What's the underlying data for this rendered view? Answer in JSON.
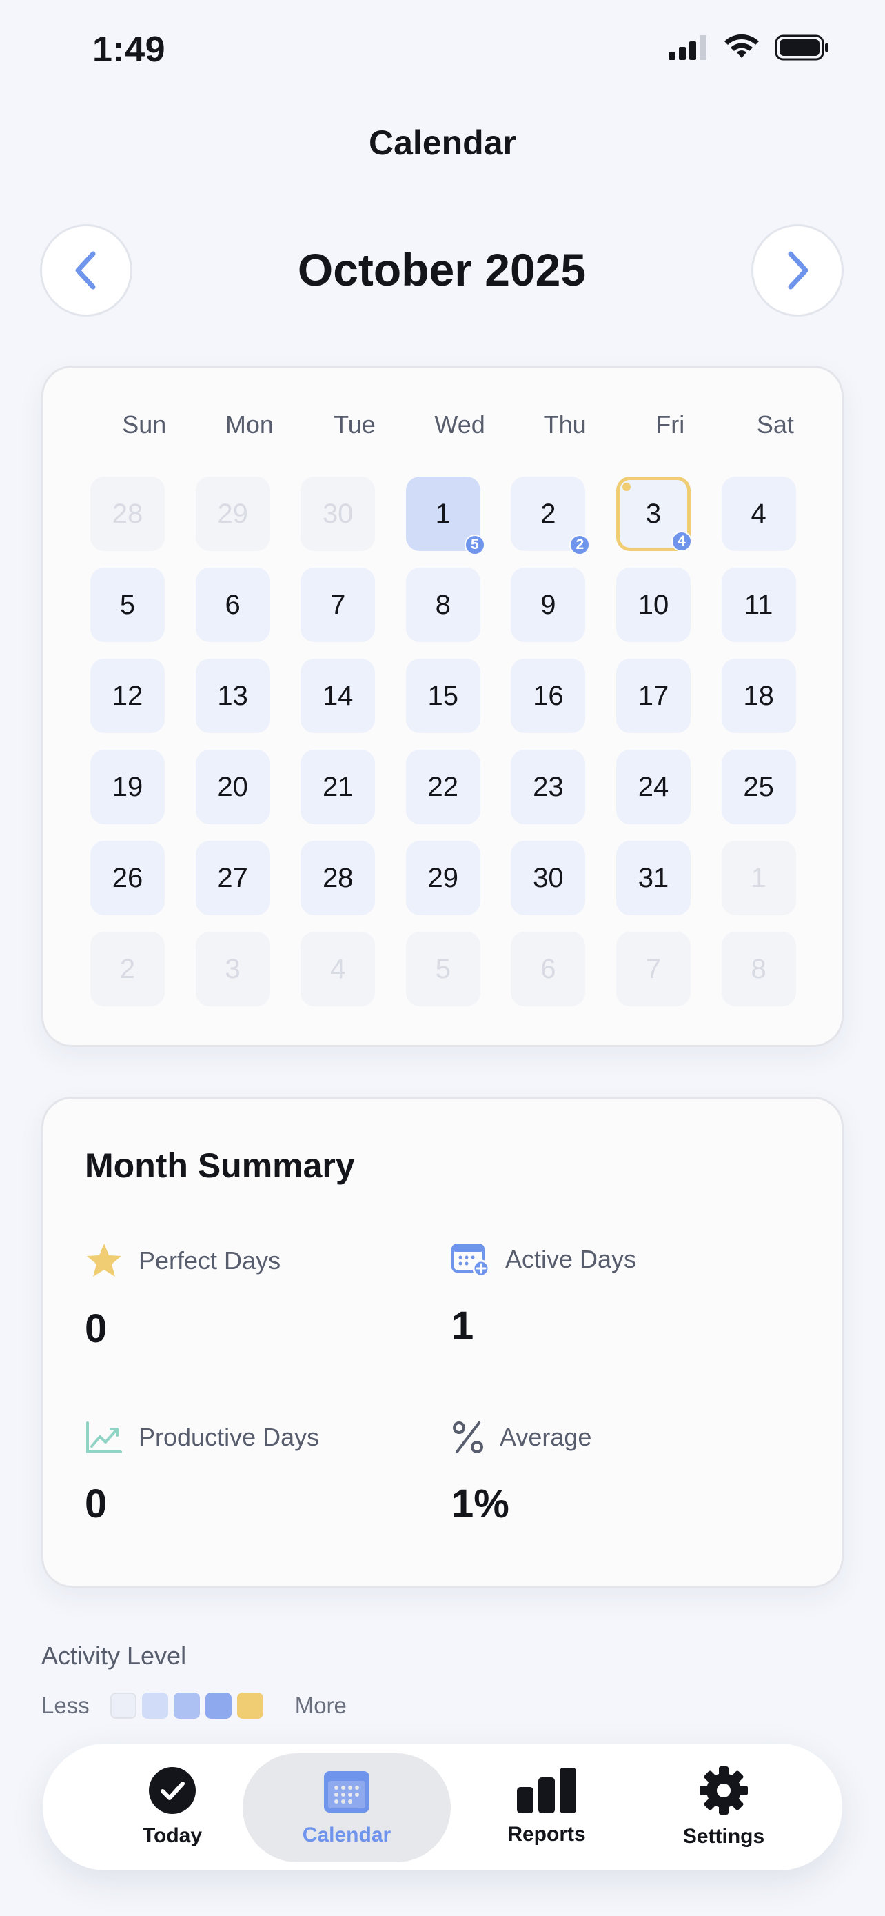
{
  "status_bar": {
    "time": "1:49"
  },
  "header": {
    "title": "Calendar"
  },
  "month_nav": {
    "label": "October 2025"
  },
  "calendar": {
    "weekdays": [
      "Sun",
      "Mon",
      "Tue",
      "Wed",
      "Thu",
      "Fri",
      "Sat"
    ],
    "days": [
      {
        "n": "28",
        "state": "muted"
      },
      {
        "n": "29",
        "state": "muted"
      },
      {
        "n": "30",
        "state": "muted"
      },
      {
        "n": "1",
        "state": "active",
        "badge": "5"
      },
      {
        "n": "2",
        "state": "normal",
        "badge": "2"
      },
      {
        "n": "3",
        "state": "today",
        "badge": "4"
      },
      {
        "n": "4",
        "state": "normal"
      },
      {
        "n": "5",
        "state": "normal"
      },
      {
        "n": "6",
        "state": "normal"
      },
      {
        "n": "7",
        "state": "normal"
      },
      {
        "n": "8",
        "state": "normal"
      },
      {
        "n": "9",
        "state": "normal"
      },
      {
        "n": "10",
        "state": "normal"
      },
      {
        "n": "11",
        "state": "normal"
      },
      {
        "n": "12",
        "state": "normal"
      },
      {
        "n": "13",
        "state": "normal"
      },
      {
        "n": "14",
        "state": "normal"
      },
      {
        "n": "15",
        "state": "normal"
      },
      {
        "n": "16",
        "state": "normal"
      },
      {
        "n": "17",
        "state": "normal"
      },
      {
        "n": "18",
        "state": "normal"
      },
      {
        "n": "19",
        "state": "normal"
      },
      {
        "n": "20",
        "state": "normal"
      },
      {
        "n": "21",
        "state": "normal"
      },
      {
        "n": "22",
        "state": "normal"
      },
      {
        "n": "23",
        "state": "normal"
      },
      {
        "n": "24",
        "state": "normal"
      },
      {
        "n": "25",
        "state": "normal"
      },
      {
        "n": "26",
        "state": "normal"
      },
      {
        "n": "27",
        "state": "normal"
      },
      {
        "n": "28",
        "state": "normal"
      },
      {
        "n": "29",
        "state": "normal"
      },
      {
        "n": "30",
        "state": "normal"
      },
      {
        "n": "31",
        "state": "normal"
      },
      {
        "n": "1",
        "state": "muted"
      },
      {
        "n": "2",
        "state": "muted"
      },
      {
        "n": "3",
        "state": "muted"
      },
      {
        "n": "4",
        "state": "muted"
      },
      {
        "n": "5",
        "state": "muted"
      },
      {
        "n": "6",
        "state": "muted"
      },
      {
        "n": "7",
        "state": "muted"
      },
      {
        "n": "8",
        "state": "muted"
      }
    ]
  },
  "summary": {
    "title": "Month Summary",
    "perfect_days": {
      "label": "Perfect Days",
      "value": "0",
      "icon": "star-icon"
    },
    "active_days": {
      "label": "Active Days",
      "value": "1",
      "icon": "calendar-plus-icon"
    },
    "productive_days": {
      "label": "Productive Days",
      "value": "0",
      "icon": "trend-up-icon"
    },
    "average": {
      "label": "Average",
      "value": "1%",
      "icon": "percent-icon"
    }
  },
  "legend": {
    "title": "Activity Level",
    "less": "Less",
    "more": "More",
    "colors": [
      "#eceff7",
      "#d0dcf8",
      "#adc1f2",
      "#8fa9ee",
      "#f0cd73"
    ]
  },
  "tabs": [
    {
      "label": "Today",
      "icon": "check-circle-icon"
    },
    {
      "label": "Calendar",
      "icon": "calendar-icon",
      "selected": true
    },
    {
      "label": "Reports",
      "icon": "bar-chart-icon"
    },
    {
      "label": "Settings",
      "icon": "gear-icon"
    }
  ],
  "colors": {
    "accent": "#6f94eb",
    "highlight": "#f0cd73",
    "background": "#f4f6fb"
  }
}
